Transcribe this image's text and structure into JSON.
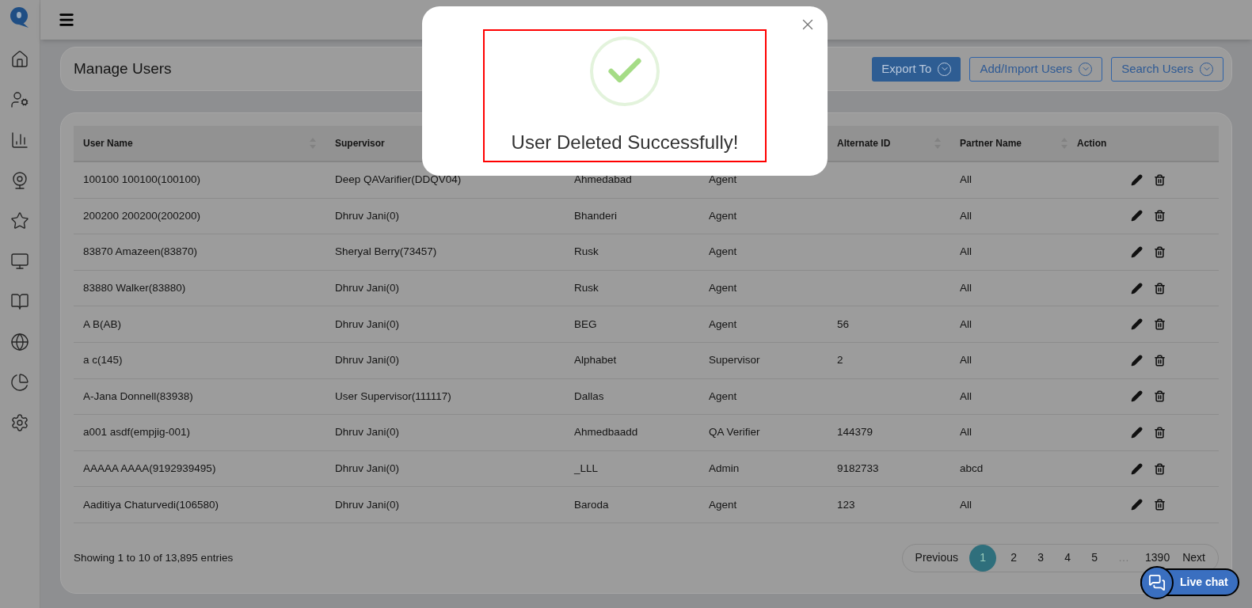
{
  "page_title": "Manage Users",
  "actions": [
    {
      "label": "Export To",
      "kind": "primary"
    },
    {
      "label": "Add/Import Users",
      "kind": "outline"
    },
    {
      "label": "Search Users",
      "kind": "outline"
    }
  ],
  "table": {
    "columns": [
      {
        "label": "User Name",
        "sortable": true
      },
      {
        "label": "Supervisor",
        "sortable": false
      },
      {
        "label": "Alternate ID",
        "sortable": true
      },
      {
        "label": "Partner Name",
        "sortable": true
      },
      {
        "label": "Action",
        "sortable": false
      }
    ],
    "rows": [
      {
        "user_name": "100100 100100(100100)",
        "supervisor": "Deep QAVarifier(DDQV04)",
        "column_3": "Ahmedabad",
        "column_4": "Agent",
        "partner_name": "All"
      },
      {
        "user_name": "200200 200200(200200)",
        "supervisor": "Dhruv Jani(0)",
        "column_3": "Bhanderi",
        "column_4": "Agent",
        "partner_name": "All"
      },
      {
        "user_name": "83870 Amazeen(83870)",
        "supervisor": "Sheryal Berry(73457)",
        "column_3": "Rusk",
        "column_4": "Agent",
        "partner_name": "All"
      },
      {
        "user_name": "83880 Walker(83880)",
        "supervisor": "Dhruv Jani(0)",
        "column_3": "Rusk",
        "column_4": "Agent",
        "partner_name": "All"
      },
      {
        "user_name": "A B(AB)",
        "supervisor": "Dhruv Jani(0)",
        "column_3": "BEG",
        "column_4": "Agent",
        "alternate_id": "56",
        "partner_name": "All"
      },
      {
        "user_name": "a c(145)",
        "supervisor": "Dhruv Jani(0)",
        "column_3": "Alphabet",
        "column_4": "Supervisor",
        "alternate_id": "2",
        "partner_name": "All"
      },
      {
        "user_name": "A-Jana Donnell(83938)",
        "supervisor": "User Supervisor(111117)",
        "column_3": "Dallas",
        "column_4": "Agent",
        "partner_name": "All"
      },
      {
        "user_name": "a001 asdf(empjig-001)",
        "supervisor": "Dhruv Jani(0)",
        "column_3": "Ahmedbaadd",
        "column_4": "QA Verifier",
        "alternate_id": "144379",
        "partner_name": "All"
      },
      {
        "user_name": "AAAAA AAAA(9192939495)",
        "supervisor": "Dhruv Jani(0)",
        "column_3": "_LLL",
        "column_4": "Admin",
        "alternate_id": "9182733",
        "partner_name": "abcd"
      },
      {
        "user_name": "Aaditiya Chaturvedi(106580)",
        "supervisor": "Dhruv Jani(0)",
        "column_3": "Baroda",
        "column_4": "Agent",
        "alternate_id": "123",
        "partner_name": "All"
      }
    ]
  },
  "entries_info": "Showing 1 to 10 of 13,895 entries",
  "pagination": [
    {
      "label": "Previous",
      "kind": "nav"
    },
    {
      "label": "1",
      "kind": "page",
      "selected": true
    },
    {
      "label": "2",
      "kind": "page",
      "selected": false
    },
    {
      "label": "3",
      "kind": "page",
      "selected": false
    },
    {
      "label": "4",
      "kind": "page",
      "selected": false
    },
    {
      "label": "5",
      "kind": "page",
      "selected": false
    },
    {
      "label": "…",
      "kind": "gap"
    },
    {
      "label": "1390",
      "kind": "page",
      "selected": false
    },
    {
      "label": "Next",
      "kind": "nav"
    }
  ],
  "modal": {
    "message": "User Deleted Successfully!"
  },
  "live_chat": {
    "label": "Live chat"
  }
}
